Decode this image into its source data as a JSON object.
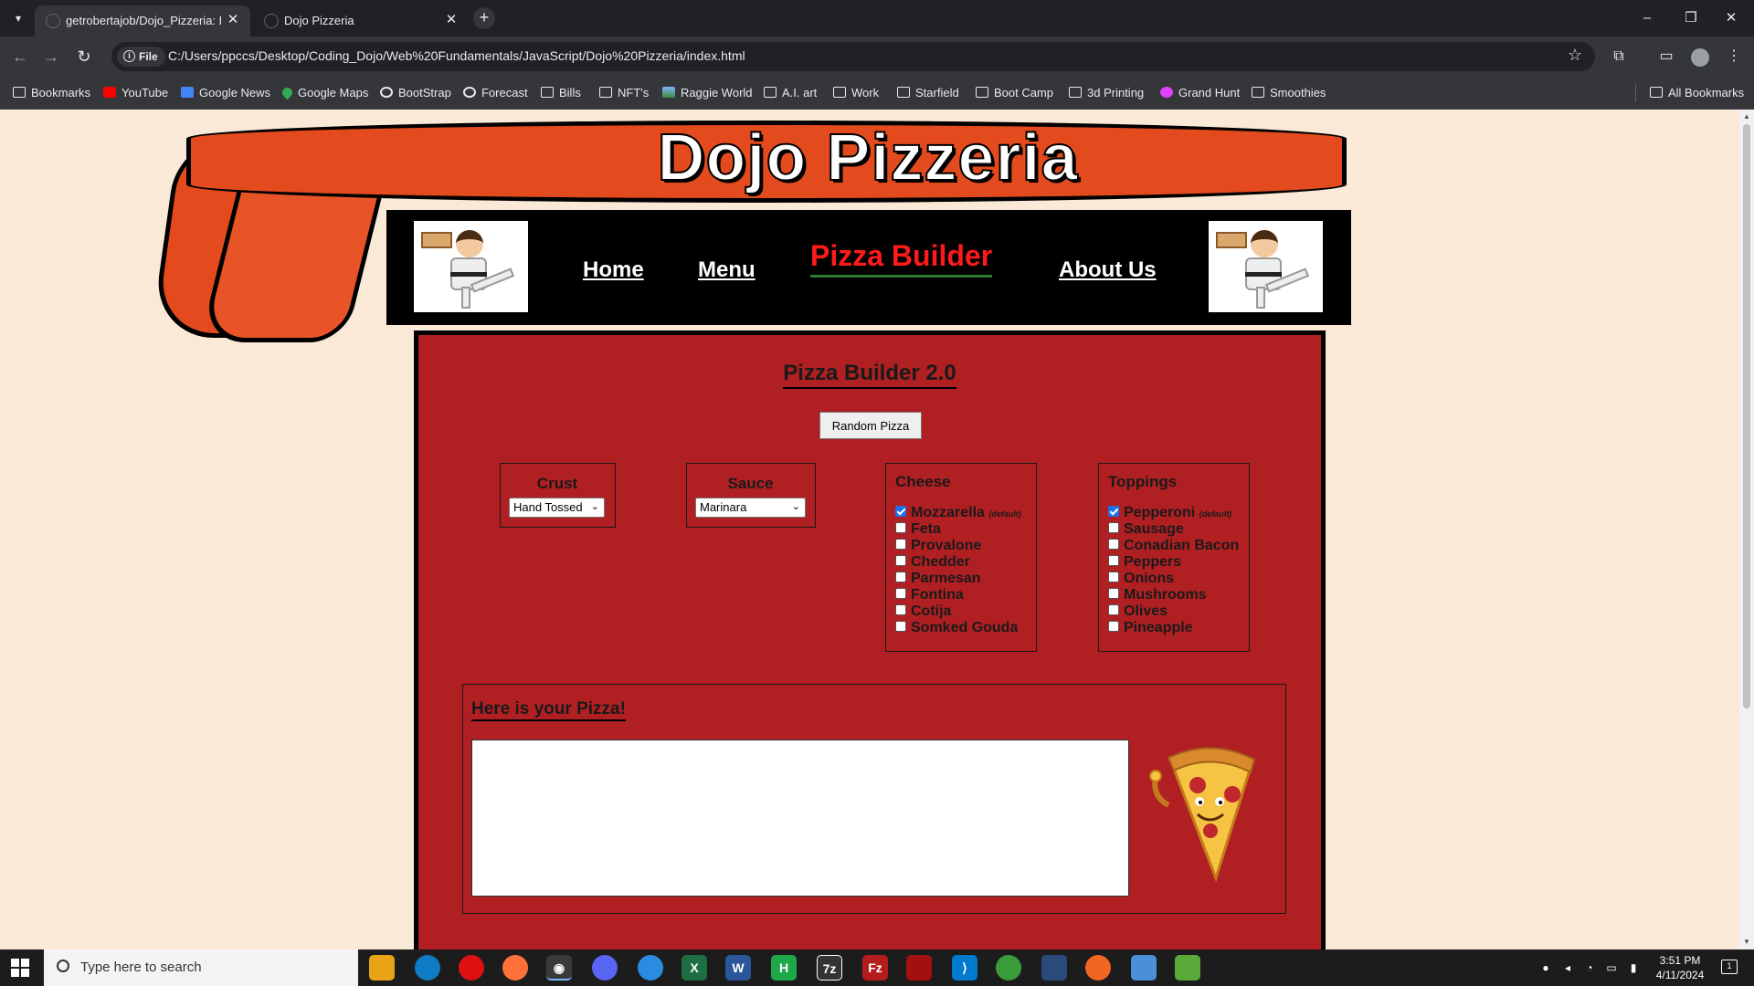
{
  "browser": {
    "tabs": [
      {
        "title": "getrobertajob/Dojo_Pizzeria: H",
        "active": false
      },
      {
        "title": "Dojo Pizzeria",
        "active": true
      }
    ],
    "address": {
      "chip": "File",
      "url": "C:/Users/ppccs/Desktop/Coding_Dojo/Web%20Fundamentals/JavaScript/Dojo%20Pizzeria/index.html"
    },
    "bookmarks": [
      {
        "label": "Bookmarks",
        "icon": "folder-icon"
      },
      {
        "label": "YouTube",
        "icon": "youtube-icon"
      },
      {
        "label": "Google News",
        "icon": "google-news-icon"
      },
      {
        "label": "Google Maps",
        "icon": "map-pin-icon"
      },
      {
        "label": "BootStrap",
        "icon": "globe-icon"
      },
      {
        "label": "Forecast",
        "icon": "globe-icon"
      },
      {
        "label": "Bills",
        "icon": "folder-icon"
      },
      {
        "label": "NFT's",
        "icon": "folder-icon"
      },
      {
        "label": "Raggie World",
        "icon": "image-icon"
      },
      {
        "label": "A.I. art",
        "icon": "folder-icon"
      },
      {
        "label": "Work",
        "icon": "folder-icon"
      },
      {
        "label": "Starfield",
        "icon": "folder-icon"
      },
      {
        "label": "Boot Camp",
        "icon": "folder-icon"
      },
      {
        "label": "3d Printing",
        "icon": "folder-icon"
      },
      {
        "label": "Grand Hunt",
        "icon": "grand-hunt-icon"
      },
      {
        "label": "Smoothies",
        "icon": "folder-icon"
      }
    ],
    "all_bookmarks": "All Bookmarks"
  },
  "page": {
    "site_title": "Dojo Pizzeria",
    "nav": [
      {
        "label": "Home"
      },
      {
        "label": "Menu"
      },
      {
        "label": "Pizza Builder",
        "current": true
      },
      {
        "label": "About Us"
      }
    ],
    "builder": {
      "title": "Pizza Builder 2.0",
      "random_button": "Random Pizza",
      "crust": {
        "label": "Crust",
        "selected": "Hand Tossed"
      },
      "sauce": {
        "label": "Sauce",
        "selected": "Marinara"
      },
      "cheese": {
        "label": "Cheese",
        "default_tag": "(default)",
        "options": [
          {
            "label": "Mozzarella",
            "checked": true
          },
          {
            "label": "Feta",
            "checked": false
          },
          {
            "label": "Provalone",
            "checked": false
          },
          {
            "label": "Chedder",
            "checked": false
          },
          {
            "label": "Parmesan",
            "checked": false
          },
          {
            "label": "Fontina",
            "checked": false
          },
          {
            "label": "Cotija",
            "checked": false
          },
          {
            "label": "Somked Gouda",
            "checked": false
          }
        ]
      },
      "toppings": {
        "label": "Toppings",
        "default_tag": "(default)",
        "options": [
          {
            "label": "Pepperoni",
            "checked": true
          },
          {
            "label": "Sausage",
            "checked": false
          },
          {
            "label": "Conadian Bacon",
            "checked": false
          },
          {
            "label": "Peppers",
            "checked": false
          },
          {
            "label": "Onions",
            "checked": false
          },
          {
            "label": "Mushrooms",
            "checked": false
          },
          {
            "label": "Olives",
            "checked": false
          },
          {
            "label": "Pineapple",
            "checked": false
          }
        ]
      },
      "result_title": "Here is your Pizza!"
    }
  },
  "taskbar": {
    "search_placeholder": "Type here to search",
    "time": "3:51 PM",
    "date": "4/11/2024",
    "notification_count": "1"
  },
  "colors": {
    "page_bg": "#fbe9d7",
    "headband": "#e34b1f",
    "panel": "#b01f22",
    "nav_current": "#ff1a1a"
  }
}
